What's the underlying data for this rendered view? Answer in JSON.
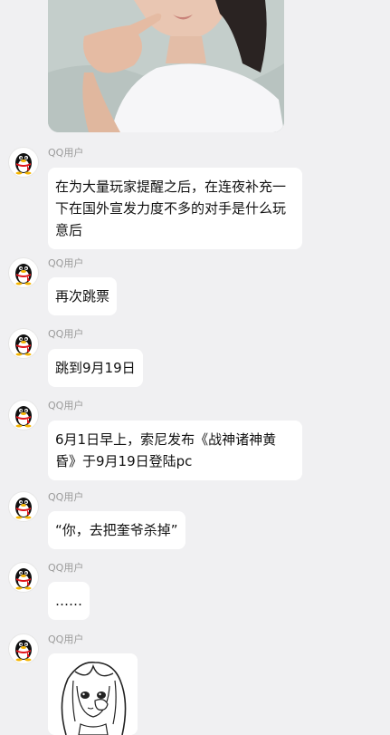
{
  "messages": [
    {
      "sender": "QQ用户",
      "text": "在为大量玩家提醒之后，在连夜补充一下在国外宣发力度不多的对手是什么玩意后"
    },
    {
      "sender": "QQ用户",
      "text": "再次跳票"
    },
    {
      "sender": "QQ用户",
      "text": "跳到9月19日"
    },
    {
      "sender": "QQ用户",
      "text": "6月1日早上，索尼发布《战神诸神黄昏》于9月19日登陆pc"
    },
    {
      "sender": "QQ用户",
      "text": "“你，去把奎爷杀掉”"
    },
    {
      "sender": "QQ用户",
      "text": "……"
    },
    {
      "sender": "QQ用户",
      "text": ""
    }
  ],
  "icons": {
    "avatar": "qq-penguin-icon",
    "sticker": "anime-girl-sticker"
  },
  "colors": {
    "background": "#f0f0f2",
    "bubble": "#ffffff",
    "sender_text": "#9a9a9a",
    "penguin_scarf": "#e0151b"
  }
}
